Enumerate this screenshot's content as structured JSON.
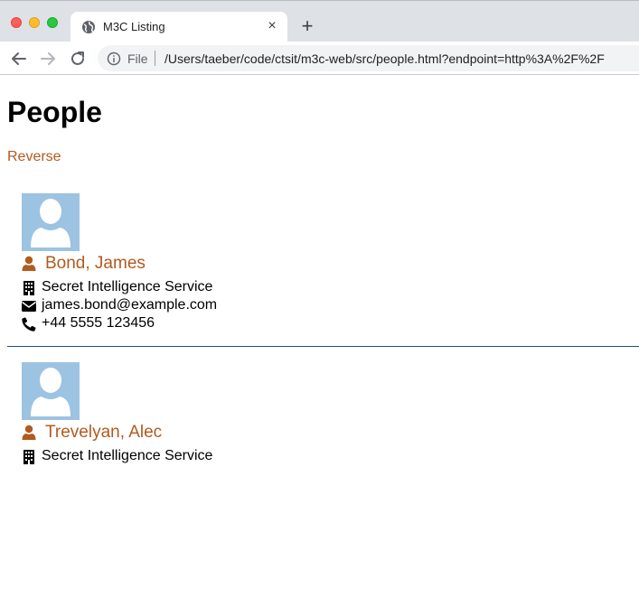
{
  "browser": {
    "tab_title": "M3C Listing",
    "tab_close": "×",
    "new_tab": "+",
    "omnibox_scheme": "File",
    "omnibox_url": "/Users/taeber/code/ctsit/m3c-web/src/people.html?endpoint=http%3A%2F%2F"
  },
  "page": {
    "title": "People",
    "reverse_label": "Reverse"
  },
  "people": [
    {
      "name": "Bond, James",
      "organization": "Secret Intelligence Service",
      "email": "james.bond@example.com",
      "phone": "+44 5555 123456"
    },
    {
      "name": "Trevelyan, Alec",
      "organization": "Secret Intelligence Service"
    }
  ],
  "colors": {
    "link": "#b35a1f",
    "avatar_bg": "#9dc3e2",
    "divider": "#2a4f7a"
  },
  "icons": {
    "name": "user-icon",
    "organization": "building-icon",
    "email": "envelope-icon",
    "phone": "phone-icon"
  }
}
